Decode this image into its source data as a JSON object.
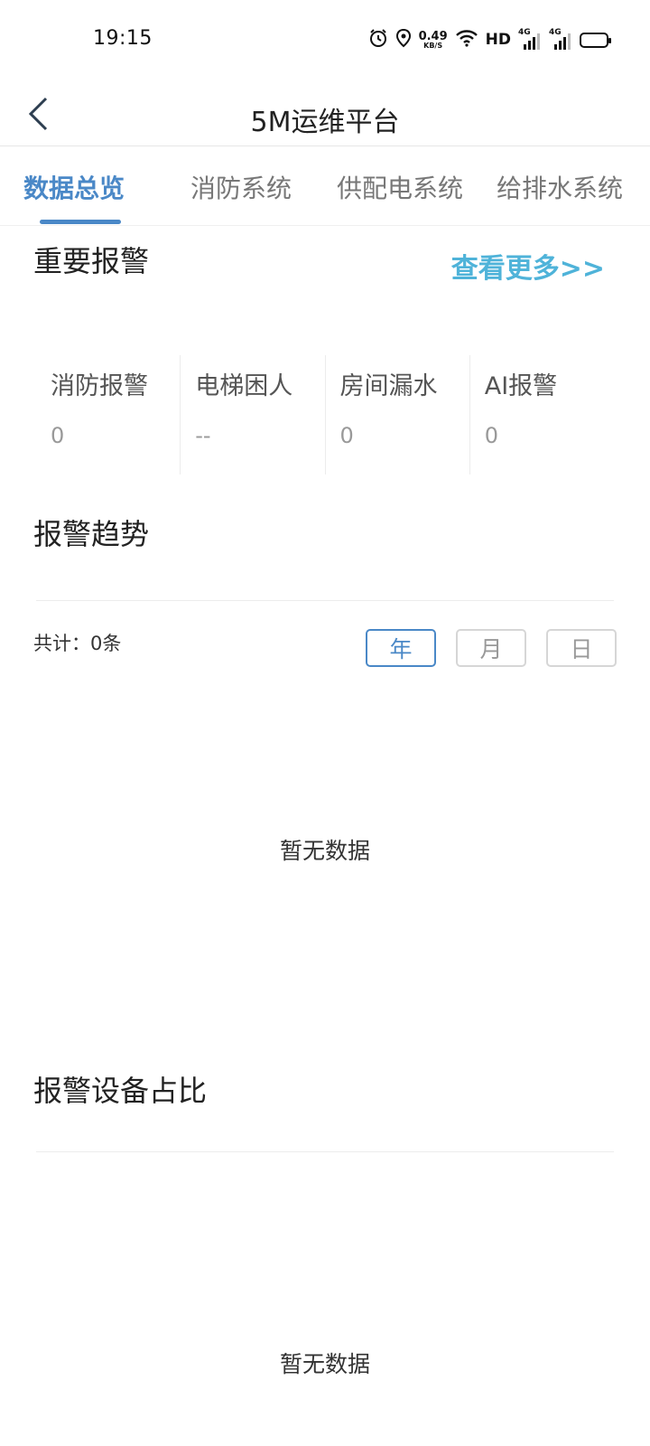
{
  "status_bar": {
    "time": "19:15",
    "net_speed_value": "0.49",
    "net_speed_unit": "KB/S",
    "hd_label": "HD",
    "sim1_tag": "4G",
    "sim2_tag": "4G",
    "icons": [
      "alarm-clock-icon",
      "location-icon",
      "wifi-icon",
      "signal-icon",
      "battery-icon"
    ]
  },
  "navbar": {
    "title": "5M运维平台"
  },
  "tabs": [
    {
      "label": "数据总览",
      "active": true
    },
    {
      "label": "消防系统",
      "active": false
    },
    {
      "label": "供配电系统",
      "active": false
    },
    {
      "label": "给排水系统",
      "active": false
    }
  ],
  "important_alarms": {
    "title": "重要报警",
    "more_link": "查看更多>>",
    "items": [
      {
        "label": "消防报警",
        "value": "0"
      },
      {
        "label": "电梯困人",
        "value": "--"
      },
      {
        "label": "房间漏水",
        "value": "0"
      },
      {
        "label": "AI报警",
        "value": "0"
      }
    ]
  },
  "alarm_trend": {
    "title": "报警趋势",
    "total": "共计：0条",
    "period_buttons": [
      {
        "label": "年",
        "active": true
      },
      {
        "label": "月",
        "active": false
      },
      {
        "label": "日",
        "active": false
      }
    ],
    "empty_text": "暂无数据"
  },
  "device_ratio": {
    "title": "报警设备占比",
    "empty_text": "暂无数据"
  },
  "colors": {
    "accent": "#4a88c7",
    "link": "#4fb3d9"
  }
}
